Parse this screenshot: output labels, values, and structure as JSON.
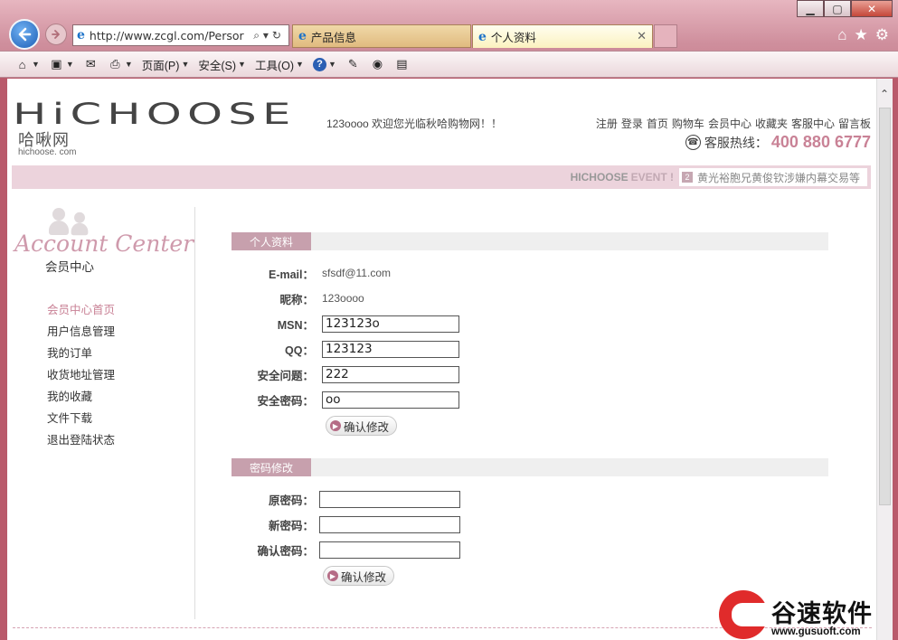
{
  "browser": {
    "window_buttons": {
      "minimize": "▁",
      "maximize": "▢",
      "close": "✕"
    },
    "back_icon": "back-arrow-icon",
    "forward_icon": "forward-arrow-icon",
    "address_url": "http://www.zcgl.com/Persor",
    "tabs": [
      {
        "label": "产品信息",
        "active": false
      },
      {
        "label": "个人资料",
        "active": true
      }
    ],
    "command_bar": {
      "page_menu": "页面(P)",
      "safety_menu": "安全(S)",
      "tools_menu": "工具(O)"
    }
  },
  "header": {
    "logo_text": "HiCHOOSE",
    "logo_cn": "哈啾网",
    "logo_en": "hichoose. com",
    "welcome": "123oooo 欢迎您光临秋哈购物网！！",
    "top_links": [
      "注册",
      "登录",
      "首页",
      "购物车",
      "会员中心",
      "收藏夹",
      "客服中心",
      "留言板"
    ],
    "hotline_label": "客服热线：",
    "hotline_number": "400 880 6777"
  },
  "event_bar": {
    "brand": "HICHOOSE",
    "event_word": "EVENT !",
    "news_number": "2",
    "news_text": "黄光裕胞兄黄俊钦涉嫌内幕交易等"
  },
  "sidebar": {
    "title_en": "Account Center",
    "title_cn": "会员中心",
    "items": [
      {
        "label": "会员中心首页",
        "active": true
      },
      {
        "label": "用户信息管理",
        "active": false
      },
      {
        "label": "我的订单",
        "active": false
      },
      {
        "label": "收货地址管理",
        "active": false
      },
      {
        "label": "我的收藏",
        "active": false
      },
      {
        "label": "文件下载",
        "active": false
      },
      {
        "label": "退出登陆状态",
        "active": false
      }
    ]
  },
  "profile": {
    "section_title": "个人资料",
    "email_label": "E-mail：",
    "email_value": "sfsdf@11.com",
    "nickname_label": "昵称：",
    "nickname_value": "123oooo",
    "msn_label": "MSN：",
    "msn_value": "123123o",
    "qq_label": "QQ：",
    "qq_value": "123123",
    "question_label": "安全问题：",
    "question_value": "222",
    "answer_label": "安全密码：",
    "answer_value": "oo",
    "submit_label": "确认修改"
  },
  "password": {
    "section_title": "密码修改",
    "old_label": "原密码：",
    "old_value": "",
    "new_label": "新密码：",
    "new_value": "",
    "confirm_label": "确认密码：",
    "confirm_value": "",
    "submit_label": "确认修改"
  },
  "watermark": {
    "title": "谷速软件",
    "url": "www.gusuoft.com"
  },
  "colors": {
    "chrome_pink": "#cf8f9d",
    "accent_pink": "#c98296",
    "section_tag": "#c7a0ad",
    "watermark_red": "#e02b2b"
  }
}
